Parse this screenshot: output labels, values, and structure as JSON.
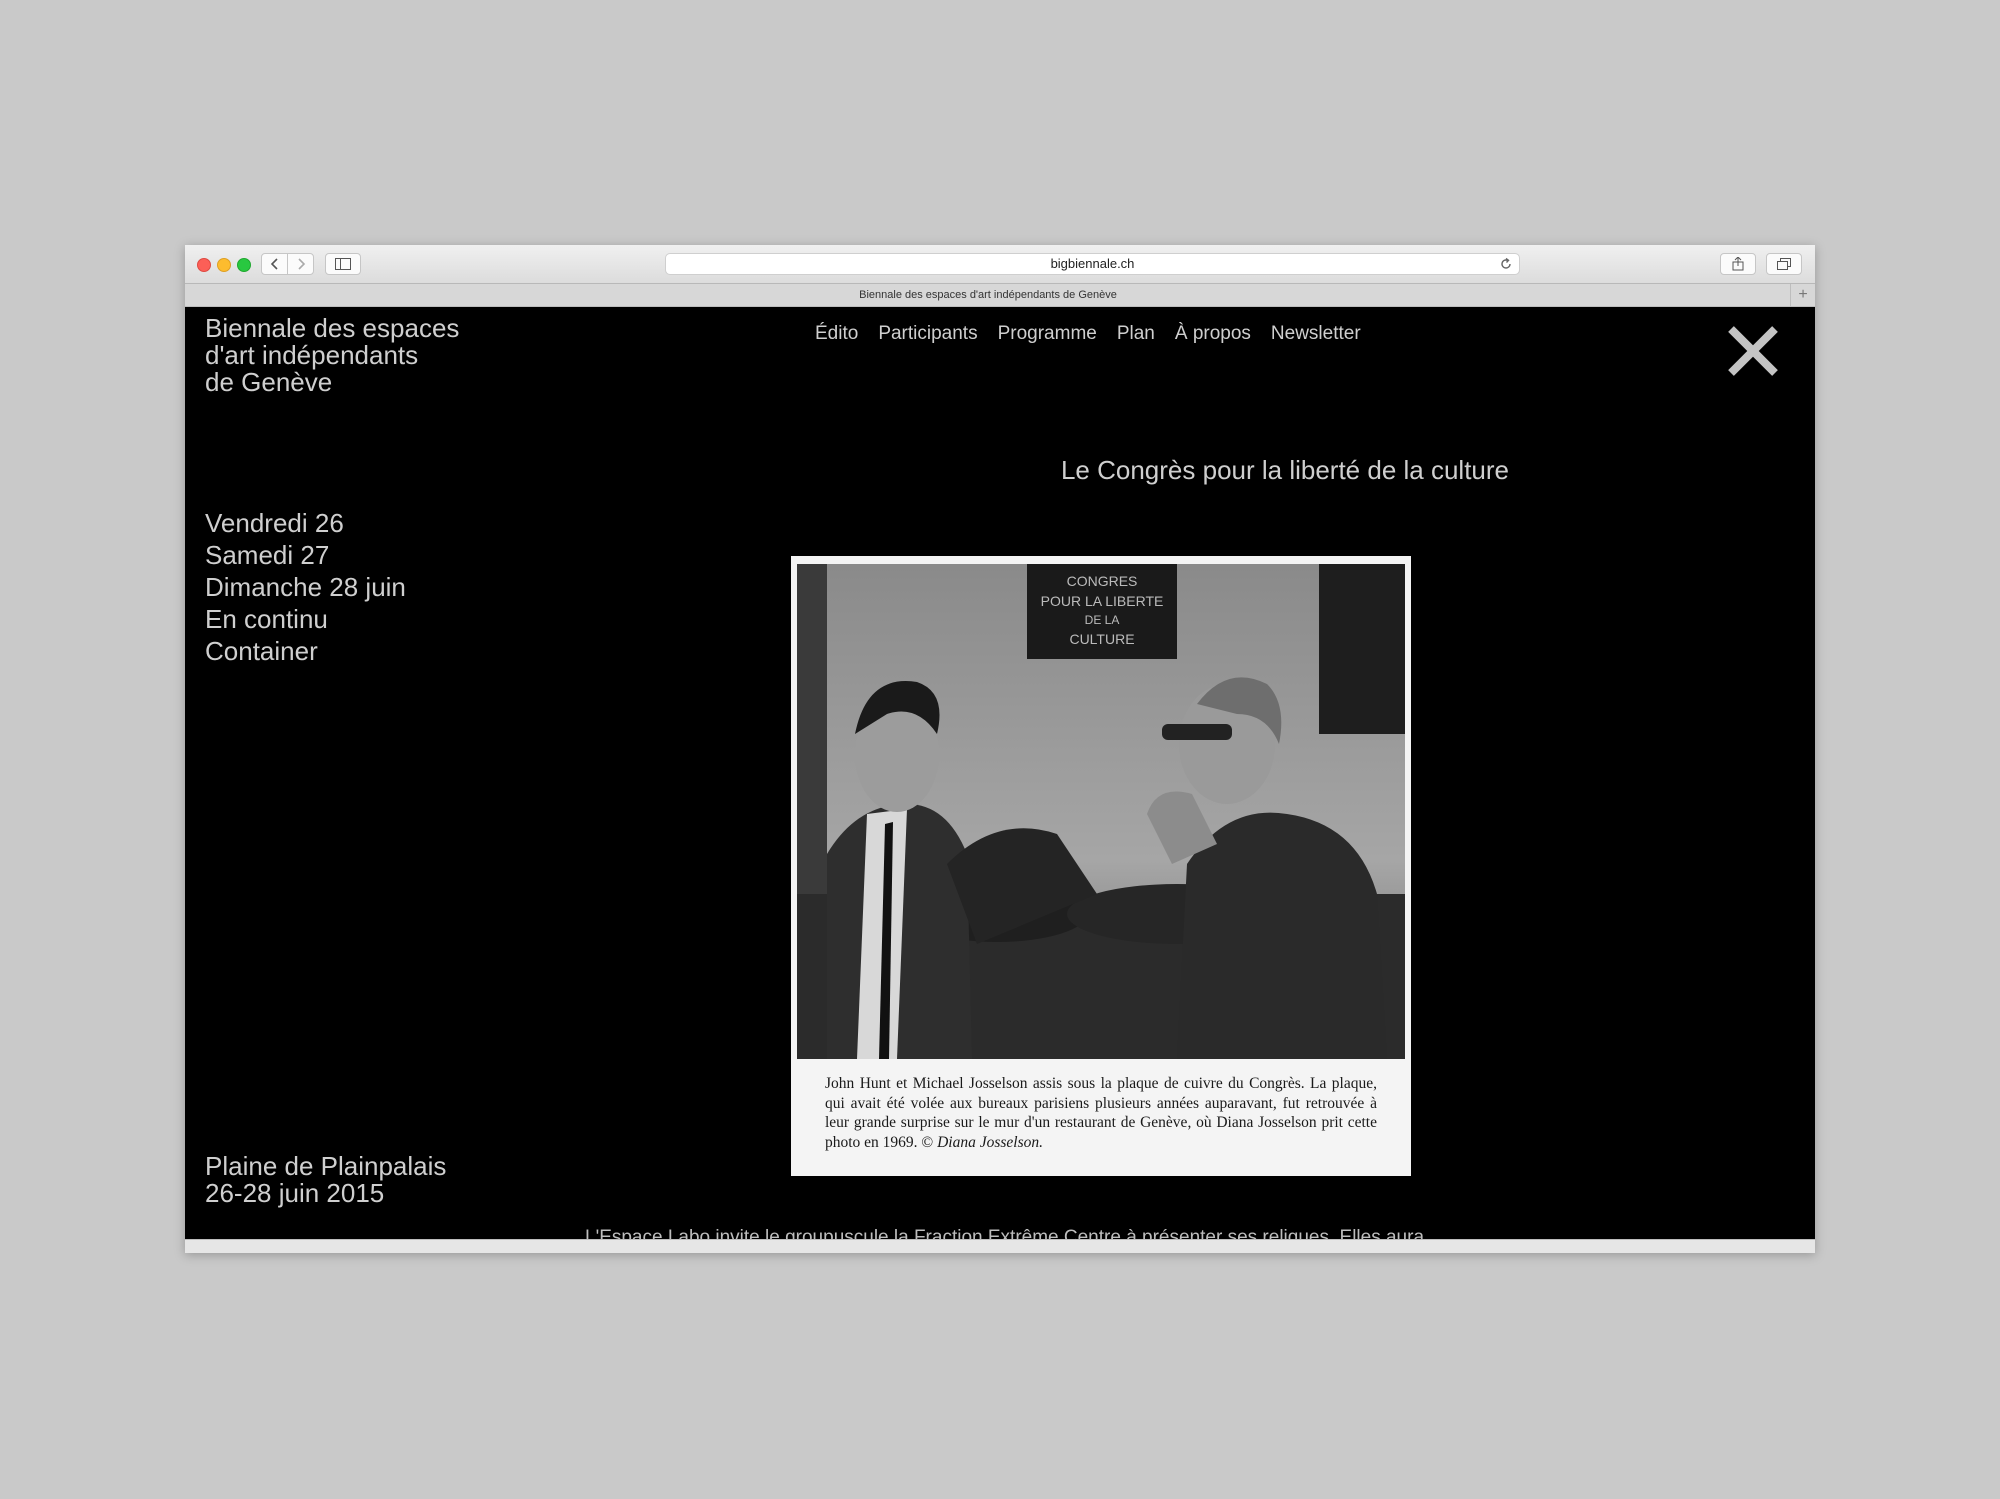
{
  "browser": {
    "url": "bigbiennale.ch",
    "tab_title": "Biennale des espaces d'art indépendants de Genève",
    "new_tab": "+"
  },
  "site": {
    "title_lines": [
      "Biennale des espaces",
      "d'art indépendants",
      "de Genève"
    ],
    "nav": [
      "Édito",
      "Participants",
      "Programme",
      "Plan",
      "À propos",
      "Newsletter"
    ]
  },
  "sidebar": {
    "days": [
      "Vendredi 26",
      "Samedi 27",
      "Dimanche 28 juin",
      "En continu",
      "Container"
    ],
    "location_lines": [
      "Plaine de Plainpalais",
      "26-28 juin 2015"
    ]
  },
  "main": {
    "heading": "Le Congrès pour la liberté de la culture",
    "photo": {
      "plaque_lines": [
        "CONGRES",
        "POUR LA LIBERTE",
        "DE LA",
        "CULTURE"
      ],
      "caption": "John Hunt et Michael Josselson assis sous la plaque de cuivre du Congrès. La plaque, qui avait été volée aux bureaux parisiens plusieurs années auparavant, fut retrouvée à leur grande surprise sur le mur d'un restaurant de Genève, où Diana Josselson prit cette photo en 1969. © ",
      "credit": "Diana Josselson."
    },
    "bottom_text": "L'Espace Labo invite le groupuscule la Fraction Extrême Centre à présenter ses reliques. Elles auraient appartenu à"
  },
  "colors": {
    "page_bg": "#000000",
    "text": "#cfcfcf",
    "desk_bg": "#c9c9c9"
  }
}
